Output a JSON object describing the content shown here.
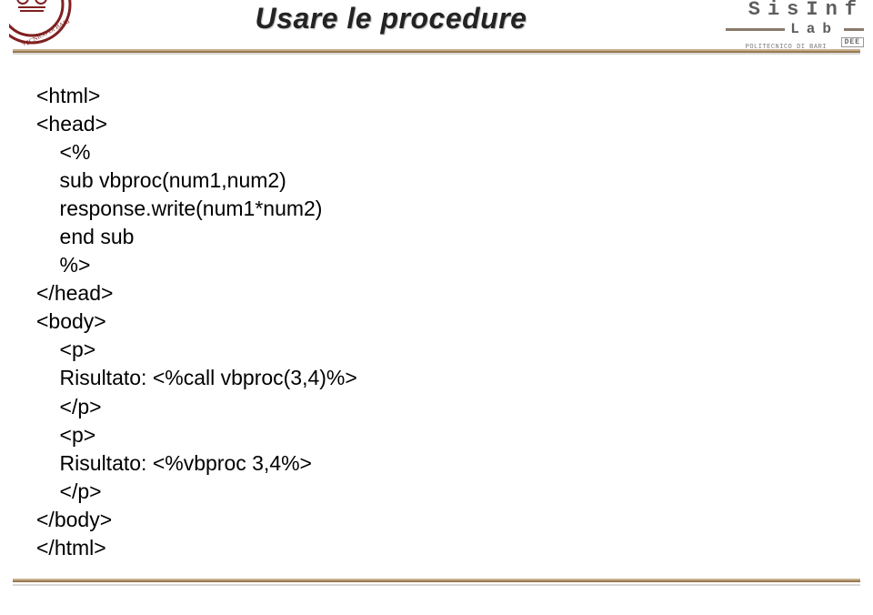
{
  "header": {
    "title": "Usare le procedure",
    "brand_top": "SisInf",
    "brand_mid": "Lab",
    "brand_sub": "POLITECNICO DI BARI",
    "brand_box": "DEE"
  },
  "code": {
    "l1": "<html>",
    "l2": "<head>",
    "l3": "    <%",
    "l4": "    sub vbproc(num1,num2)",
    "l5": "    response.write(num1*num2)",
    "l6": "    end sub",
    "l7": "    %>",
    "l8": "</head>",
    "l9": "<body>",
    "l10": "    <p>",
    "l11": "    Risultato: <%call vbproc(3,4)%>",
    "l12": "    </p>",
    "l13": "    <p>",
    "l14": "    Risultato: <%vbproc 3,4%>",
    "l15": "    </p>",
    "l16": "</body>",
    "l17": "</html>"
  }
}
